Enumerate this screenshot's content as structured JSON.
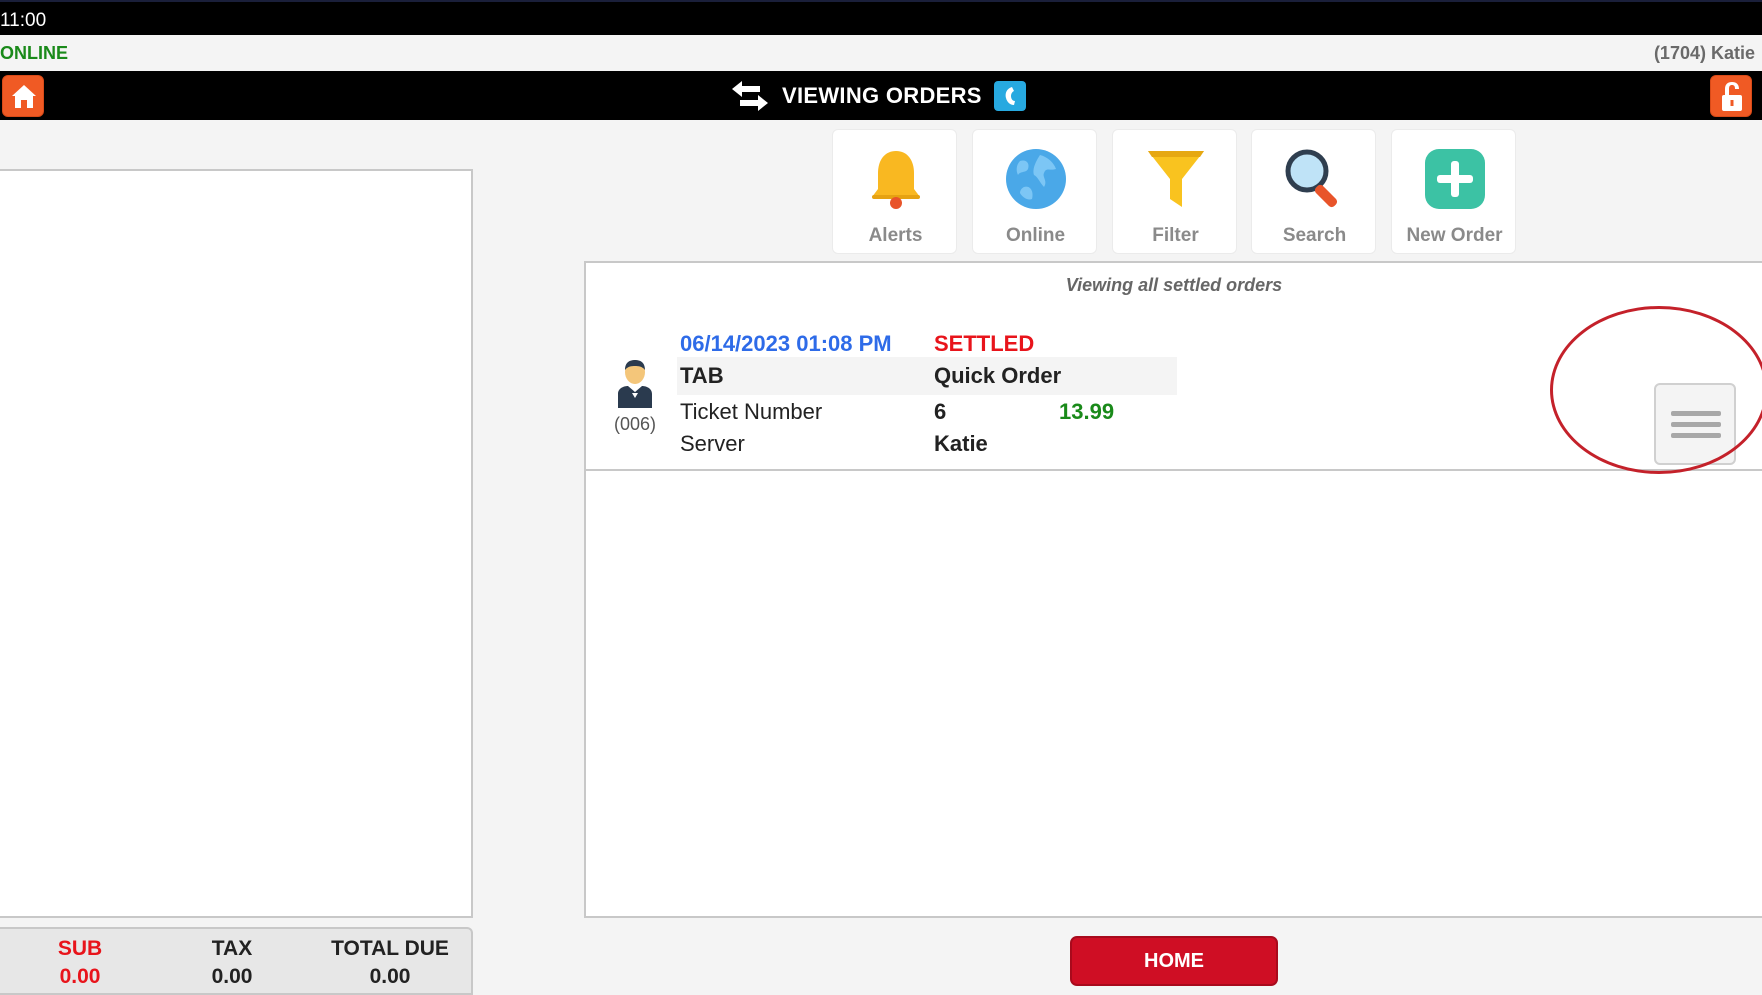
{
  "status_bar": {
    "time": "11:00"
  },
  "network_bar": {
    "status": "ONLINE",
    "user": "(1704) Katie"
  },
  "title_bar": {
    "title": "VIEWING ORDERS"
  },
  "toolbar": {
    "alerts_label": "Alerts",
    "online_label": "Online",
    "filter_label": "Filter",
    "search_label": "Search",
    "new_order_label": "New Order"
  },
  "orders": {
    "caption": "Viewing all settled orders",
    "items": [
      {
        "server_code": "(006)",
        "datetime": "06/14/2023 01:08 PM",
        "status": "SETTLED",
        "type": "TAB",
        "name": "Quick Order",
        "ticket_label": "Ticket Number",
        "ticket_number": "6",
        "amount": "13.99",
        "server_label": "Server",
        "server": "Katie"
      }
    ]
  },
  "totals": {
    "sub_label": "SUB",
    "sub_value": "0.00",
    "tax_label": "TAX",
    "tax_value": "0.00",
    "total_label": "TOTAL DUE",
    "total_value": "0.00"
  },
  "footer": {
    "home_label": "HOME"
  },
  "colors": {
    "accent_orange": "#f05a24",
    "home_red": "#cf0e24",
    "settled_red": "#e8141b",
    "date_blue": "#2e6be8",
    "amount_green": "#1a8a1a",
    "online_green": "#1a8a1a"
  },
  "icons": [
    "home-icon",
    "swap-arrows-icon",
    "phone-icon",
    "lock-icon",
    "bell-icon",
    "globe-icon",
    "funnel-icon",
    "magnifier-icon",
    "plus-icon",
    "server-avatar-icon",
    "hamburger-menu-icon"
  ]
}
